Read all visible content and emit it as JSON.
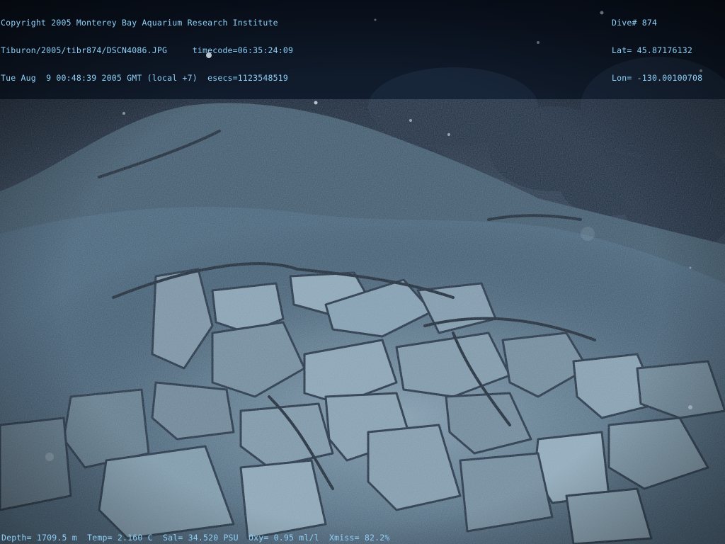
{
  "overlay": {
    "top_left": [
      "Copyright 2005 Monterey Bay Aquarium Research Institute",
      "Tiburon/2005/tibr874/DSCN4086.JPG     timecode=06:35:24:09",
      "Tue Aug  9 00:48:39 2005 GMT (local +7)  esecs=1123548519"
    ],
    "top_right": [
      "Dive# 874",
      "Lat= 45.87176132",
      "Lon= -130.00100708"
    ],
    "bottom": "Depth= 1709.5 m  Temp= 2.160 C  Sal= 34.520 PSU  Oxy= 0.95 ml/l  Xmiss= 82.2%"
  },
  "colors": {
    "overlay_text": "#8fd0f7",
    "deep_water": "#0b1420",
    "rock_light": "#7d98a8",
    "rock_mid": "#4d6678",
    "rock_dark": "#22354a"
  }
}
